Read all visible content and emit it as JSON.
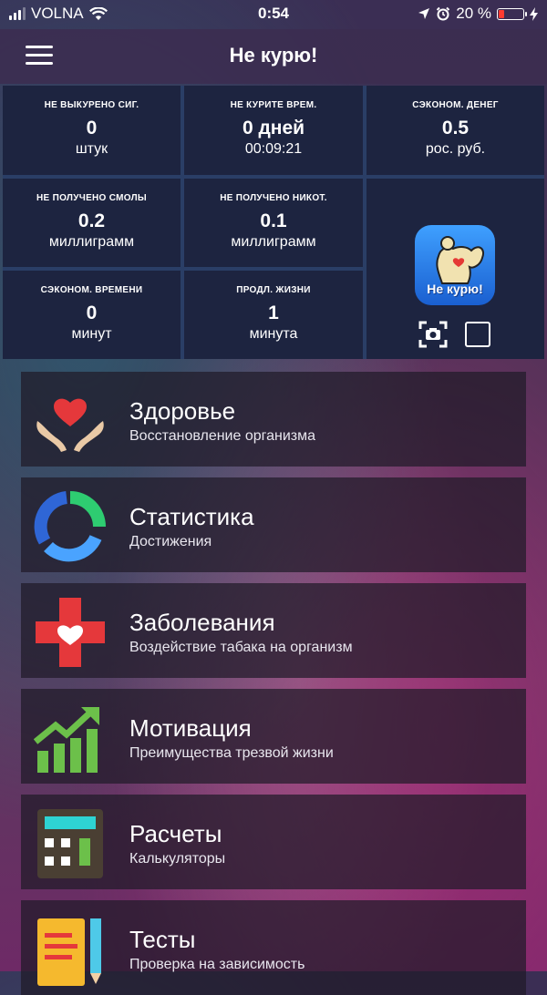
{
  "status_bar": {
    "carrier": "VOLNA",
    "time": "0:54",
    "battery_percent": "20 %",
    "battery_level": 0.2
  },
  "nav": {
    "title": "Не курю!"
  },
  "stats": [
    {
      "label": "НЕ ВЫКУРЕНО СИГ.",
      "value": "0",
      "unit": "штук"
    },
    {
      "label": "НЕ КУРИТЕ ВРЕМ.",
      "value": "0 дней",
      "unit": "00:09:21"
    },
    {
      "label": "СЭКОНОМ. ДЕНЕГ",
      "value": "0.5",
      "unit": "рос. руб."
    },
    {
      "label": "НЕ ПОЛУЧЕНО СМОЛЫ",
      "value": "0.2",
      "unit": "миллиграмм"
    },
    {
      "label": "НЕ ПОЛУЧЕНО НИКОТ.",
      "value": "0.1",
      "unit": "миллиграмм"
    },
    {
      "label": "СЭКОНОМ. ВРЕМЕНИ",
      "value": "0",
      "unit": "минут"
    },
    {
      "label": "ПРОДЛ. ЖИЗНИ",
      "value": "1",
      "unit": "минута"
    }
  ],
  "app_badge": {
    "text": "Не курю!"
  },
  "menu": [
    {
      "title": "Здоровье",
      "subtitle": "Восстановление организма",
      "icon": "health-hands-heart-icon"
    },
    {
      "title": "Статистика",
      "subtitle": "Достижения",
      "icon": "statistics-ring-icon"
    },
    {
      "title": "Заболевания",
      "subtitle": "Воздействие табака на организм",
      "icon": "medical-cross-heart-icon"
    },
    {
      "title": "Мотивация",
      "subtitle": "Преимущества трезвой жизни",
      "icon": "growth-chart-icon"
    },
    {
      "title": "Расчеты",
      "subtitle": "Калькуляторы",
      "icon": "calculator-icon"
    },
    {
      "title": "Тесты",
      "subtitle": "Проверка на зависимость",
      "icon": "test-notepad-icon"
    }
  ]
}
